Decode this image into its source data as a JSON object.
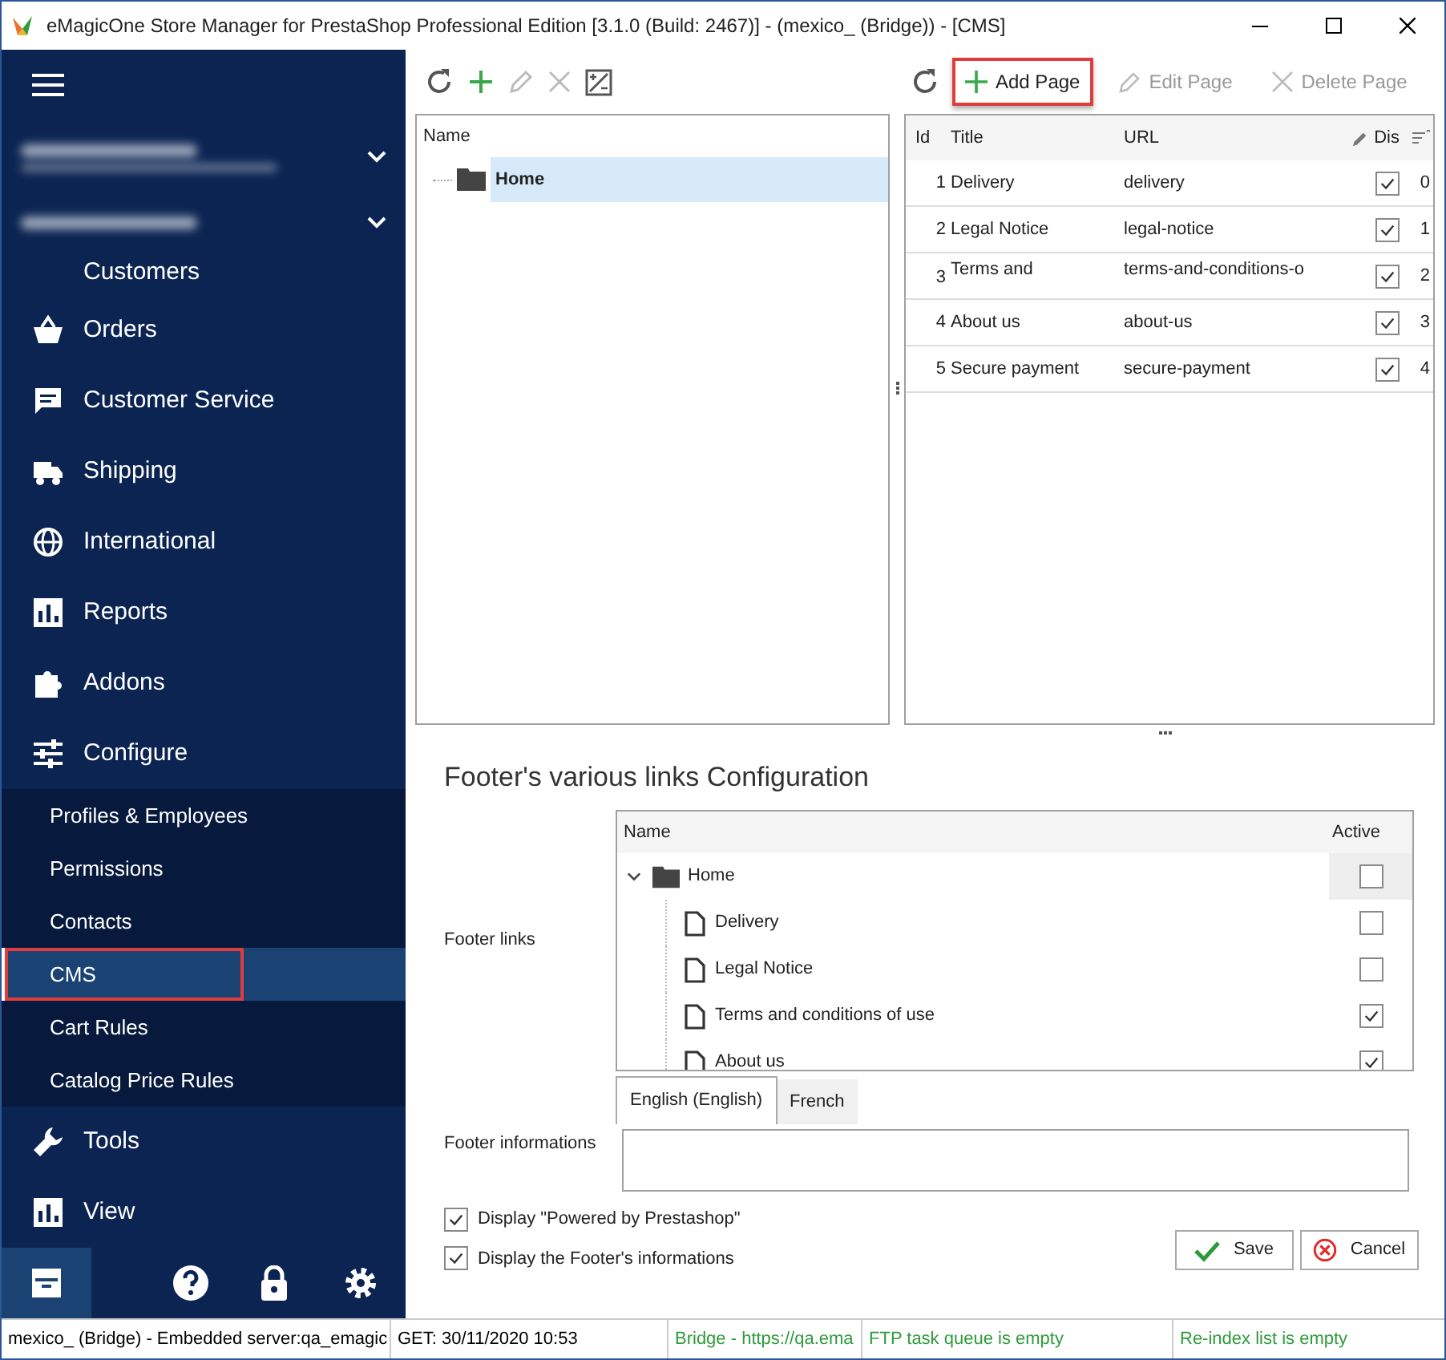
{
  "window": {
    "title": "eMagicOne Store Manager for PrestaShop Professional Edition [3.1.0 (Build: 2467)] - (mexico_ (Bridge)) - [CMS]"
  },
  "sidebar": {
    "items": [
      {
        "label": "Customers",
        "selected": false
      },
      {
        "label": "Orders",
        "selected": false
      },
      {
        "label": "Customer Service",
        "selected": false
      },
      {
        "label": "Shipping",
        "selected": false
      },
      {
        "label": "International",
        "selected": false
      },
      {
        "label": "Reports",
        "selected": false
      },
      {
        "label": "Addons",
        "selected": false
      },
      {
        "label": "Configure",
        "selected": false,
        "children": [
          {
            "label": "Profiles & Employees",
            "selected": false
          },
          {
            "label": "Permissions",
            "selected": false
          },
          {
            "label": "Contacts",
            "selected": false
          },
          {
            "label": "CMS",
            "selected": true,
            "annotated": true
          },
          {
            "label": "Cart Rules",
            "selected": false
          },
          {
            "label": "Catalog Price Rules",
            "selected": false
          }
        ]
      },
      {
        "label": "Tools",
        "selected": false
      },
      {
        "label": "View",
        "selected": false
      }
    ]
  },
  "category_tree": {
    "columns": [
      "Name"
    ],
    "nodes": [
      {
        "label": "Home",
        "selected": true
      }
    ]
  },
  "pages_toolbar": [
    {
      "label": "Add Page",
      "disabled": false,
      "annotated": true
    },
    {
      "label": "Edit Page",
      "disabled": true,
      "annotated": false
    },
    {
      "label": "Delete Page",
      "disabled": true,
      "annotated": false
    }
  ],
  "pages_table": {
    "columns": [
      "Id",
      "Title",
      "URL",
      "Dis"
    ],
    "rows": [
      {
        "id": "1",
        "title": "Delivery",
        "url": "delivery",
        "checked": true,
        "column_5": "0"
      },
      {
        "id": "2",
        "title": "Legal Notice",
        "url": "legal-notice",
        "checked": true,
        "column_5": "1"
      },
      {
        "id": "3",
        "title": "Terms and",
        "url": "terms-and-conditions-o",
        "checked": true,
        "column_5": "2"
      },
      {
        "id": "4",
        "title": "About us",
        "url": "about-us",
        "checked": true,
        "column_5": "3"
      },
      {
        "id": "5",
        "title": "Secure payment",
        "url": "secure-payment",
        "checked": true,
        "column_5": "4"
      }
    ]
  },
  "footer_config": {
    "title": "Footer's various links Configuration",
    "links_label": "Footer links",
    "links_tree": {
      "columns": [
        "Name",
        "Active"
      ],
      "nodes": [
        {
          "label": "Home",
          "expanded": true,
          "checked": false,
          "children": [
            {
              "label": "Delivery",
              "checked": false
            },
            {
              "label": "Legal Notice",
              "checked": false
            },
            {
              "label": "Terms and conditions of use",
              "checked": true
            },
            {
              "label": "About us",
              "checked": true
            }
          ]
        }
      ]
    },
    "info_label": "Footer informations",
    "tabs": [
      {
        "label": "English (English)",
        "selected": true
      },
      {
        "label": "French",
        "selected": false
      }
    ],
    "options": [
      {
        "label": "Display \"Powered by Prestashop\"",
        "checked": true
      },
      {
        "label": "Display the Footer's informations",
        "checked": true
      }
    ],
    "buttons": [
      {
        "kind": "save",
        "label": "Save"
      },
      {
        "kind": "cancel",
        "label": "Cancel"
      }
    ]
  },
  "status_bar": [
    {
      "text": "mexico_ (Bridge) - Embedded server:qa_emagic",
      "color": "#000000"
    },
    {
      "text": "GET: 30/11/2020 10:53",
      "color": "#000000"
    },
    {
      "text": "Bridge - https://qa.ema",
      "color": "#2e9a3a"
    },
    {
      "text": "FTP task queue is empty",
      "color": "#2e9a3a"
    },
    {
      "text": "Re-index list is empty",
      "color": "#2e9a3a"
    }
  ]
}
